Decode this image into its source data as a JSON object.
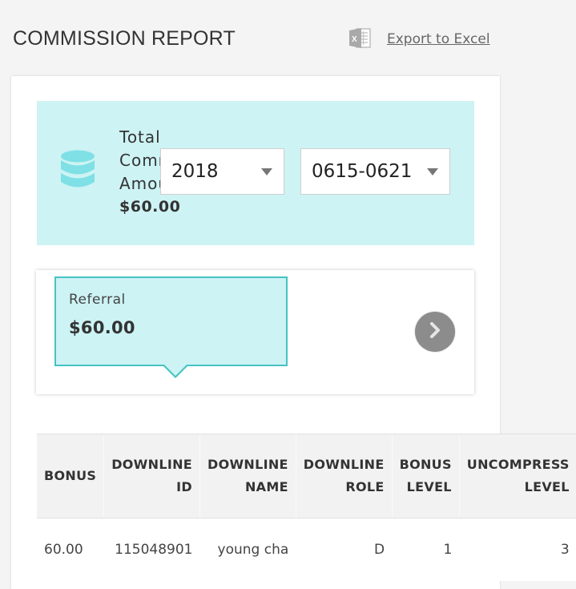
{
  "header": {
    "title": "COMMISSION REPORT",
    "export_label": "Export to Excel",
    "export_icon": "excel-icon"
  },
  "summary": {
    "icon": "database-icon",
    "label_lines": [
      "Total",
      "Commission",
      "Amount"
    ],
    "amount": "$60.00",
    "year": "2018",
    "week": "0615-0621"
  },
  "bonus_tile": {
    "label": "Referral",
    "amount": "$60.00",
    "next_icon": "chevron-right-icon"
  },
  "table": {
    "headers": [
      {
        "line1": "BONUS",
        "line2": ""
      },
      {
        "line1": "DOWNLINE",
        "line2": "ID"
      },
      {
        "line1": "DOWNLINE",
        "line2": "NAME"
      },
      {
        "line1": "DOWNLINE",
        "line2": "ROLE"
      },
      {
        "line1": "BONUS",
        "line2": "LEVEL"
      },
      {
        "line1": "UNCOMPRESS",
        "line2": "LEVEL"
      }
    ],
    "rows": [
      [
        "60.00",
        "115048901",
        "young cha",
        "D",
        "1",
        "3"
      ]
    ]
  },
  "colors": {
    "accent_bg": "#cdf3f4",
    "accent_border": "#48c3c3",
    "icon": "#7fe0e5"
  }
}
